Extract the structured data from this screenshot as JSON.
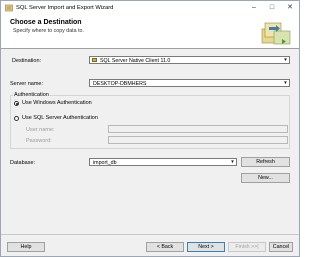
{
  "window": {
    "title": "SQL Server Import and Export Wizard",
    "controls": {
      "minimize": "–",
      "maximize": "□",
      "close": "✕"
    }
  },
  "header": {
    "title": "Choose a Destination",
    "subtitle": "Specify where to copy data to."
  },
  "form": {
    "destination_label": "Destination:",
    "destination_value": "SQL Server Native Client 11.0",
    "server_name_label": "Server name:",
    "server_name_value": "DESKTOP-DBMHERS",
    "authentication": {
      "legend": "Authentication",
      "windows_auth_label": "Use Windows Authentication",
      "sql_auth_label": "Use SQL Server Authentication",
      "selected": "windows",
      "user_name_label": "User name:",
      "user_name_value": "",
      "password_label": "Password:",
      "password_value": ""
    },
    "database_label": "Database:",
    "database_value": "import_db",
    "refresh_button": "Refresh",
    "new_button": "New..."
  },
  "footer": {
    "help_button": "Help",
    "back_button": "< Back",
    "next_button": "Next >",
    "finish_button": "Finish >>|",
    "cancel_button": "Cancel"
  },
  "icons": {
    "app": "sql-server-wizard-icon",
    "header": "database-copy-graphic"
  }
}
